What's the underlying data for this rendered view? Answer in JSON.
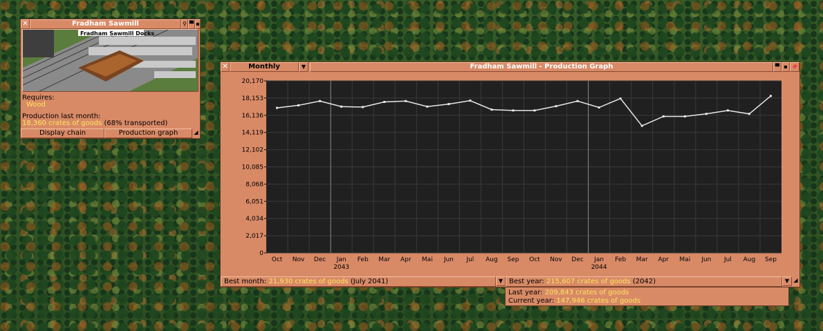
{
  "industry_window": {
    "title": "Fradham Sawmill",
    "viewport_label": "Fradham Sawmill Docks",
    "requires_label": "Requires:",
    "requires_value": "Wood",
    "production_label": "Production last month:",
    "production_value": "18,360 crates of goods",
    "production_transported": "(68% transported)",
    "display_chain_button": "Display chain",
    "production_graph_button": "Production graph"
  },
  "graph_window": {
    "title": "Fradham Sawmill - Production Graph",
    "period_dropdown": "Monthly",
    "best_month_label": "Best month:",
    "best_month_value": "21,930 crates of goods",
    "best_month_when": "(July 2041)",
    "best_year_label": "Best year:",
    "best_year_value": "215,607 crates of goods",
    "best_year_when": "(2042)",
    "last_year_label": "Last year:",
    "last_year_value": "209,843 crates of goods",
    "current_year_label": "Current year:",
    "current_year_value": "147,946 crates of goods"
  },
  "chart_data": {
    "type": "line",
    "categories": [
      "Oct",
      "Nov",
      "Dec",
      "Jan",
      "Feb",
      "Mar",
      "Apr",
      "Mai",
      "Jun",
      "Jul",
      "Aug",
      "Sep",
      "Oct",
      "Nov",
      "Dec",
      "Jan",
      "Feb",
      "Mar",
      "Apr",
      "Mai",
      "Jun",
      "Jul",
      "Aug",
      "Sep"
    ],
    "year_labels": [
      {
        "index": 3,
        "label": "2043"
      },
      {
        "index": 15,
        "label": "2044"
      }
    ],
    "y_ticks": [
      "0",
      "2,017",
      "4,034",
      "6,051",
      "8,068",
      "10,085",
      "12,102",
      "14,119",
      "16,136",
      "18,153",
      "20,170"
    ],
    "ylim": [
      0,
      20170
    ],
    "values": [
      17000,
      17300,
      17800,
      17150,
      17100,
      17700,
      17800,
      17150,
      17450,
      17850,
      16800,
      16700,
      16700,
      17200,
      17800,
      17050,
      18100,
      14900,
      16000,
      16000,
      16300,
      16700,
      16300,
      18400
    ],
    "grid": true,
    "colors": {
      "background": "#202020",
      "line": "#e8e8e8",
      "grid": "#3a3a3a"
    }
  }
}
